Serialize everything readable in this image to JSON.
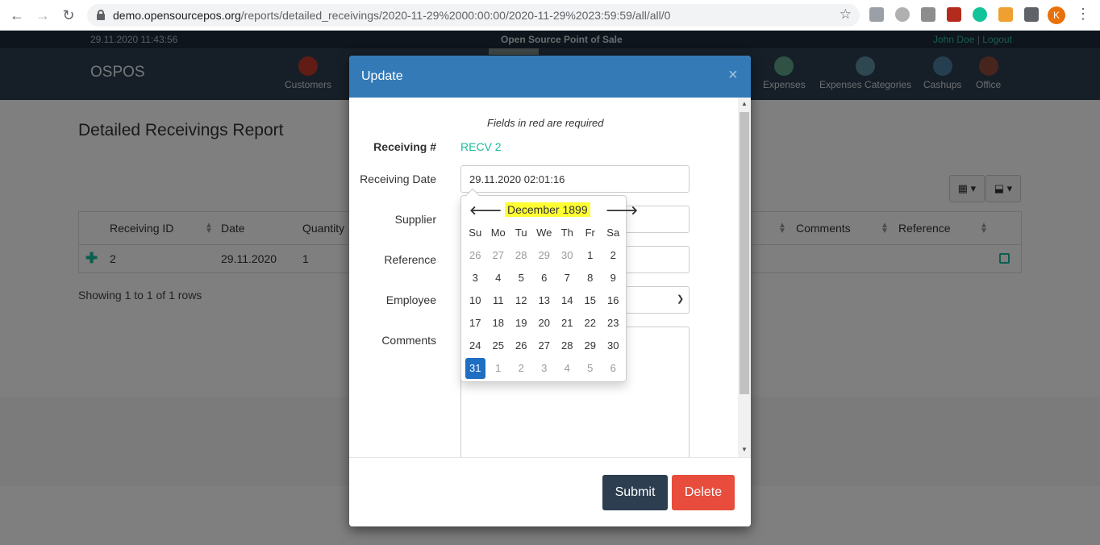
{
  "browser": {
    "url_host": "demo.opensourcepos.org",
    "url_path": "/reports/detailed_receivings/2020-11-29%2000:00:00/2020-11-29%2023:59:59/all/all/0",
    "profile_initial": "K"
  },
  "app": {
    "datetime": "29.11.2020 11:43:56",
    "title": "Open Source Point of Sale",
    "user": "John Doe",
    "separator": "|",
    "logout": "Logout",
    "brand": "OSPOS",
    "nav": [
      {
        "label": "Customers",
        "icon": "customers-icon"
      },
      {
        "label": "Expenses",
        "icon": "expenses-icon"
      },
      {
        "label": "Expenses Categories",
        "icon": "expenses-categories-icon"
      },
      {
        "label": "Cashups",
        "icon": "cashups-icon"
      },
      {
        "label": "Office",
        "icon": "office-icon"
      }
    ]
  },
  "report": {
    "title": "Detailed Receivings Report",
    "columns": [
      "Receiving ID",
      "Date",
      "Quantity",
      "Comments",
      "Reference"
    ],
    "row": {
      "id": "2",
      "date": "29.11.2020",
      "quantity": "1"
    },
    "showing": "Showing 1 to 1 of 1 rows"
  },
  "modal": {
    "title": "Update",
    "close": "×",
    "required_note": "Fields in red are required",
    "labels": {
      "receiving_no": "Receiving #",
      "receiving_date": "Receiving Date",
      "supplier": "Supplier",
      "reference": "Reference",
      "employee": "Employee",
      "comments": "Comments"
    },
    "receiving_no_value": "RECV 2",
    "receiving_date_value": "29.11.2020 02:01:16",
    "submit": "Submit",
    "delete": "Delete"
  },
  "datepicker": {
    "month": "December 1899",
    "prev": "🡐",
    "next": "🡒",
    "dow": [
      "Su",
      "Mo",
      "Tu",
      "We",
      "Th",
      "Fr",
      "Sa"
    ],
    "weeks": [
      [
        {
          "d": "26",
          "o": true
        },
        {
          "d": "27",
          "o": true
        },
        {
          "d": "28",
          "o": true
        },
        {
          "d": "29",
          "o": true
        },
        {
          "d": "30",
          "o": true
        },
        {
          "d": "1"
        },
        {
          "d": "2"
        }
      ],
      [
        {
          "d": "3"
        },
        {
          "d": "4"
        },
        {
          "d": "5"
        },
        {
          "d": "6"
        },
        {
          "d": "7"
        },
        {
          "d": "8"
        },
        {
          "d": "9"
        }
      ],
      [
        {
          "d": "10"
        },
        {
          "d": "11"
        },
        {
          "d": "12"
        },
        {
          "d": "13"
        },
        {
          "d": "14"
        },
        {
          "d": "15"
        },
        {
          "d": "16"
        }
      ],
      [
        {
          "d": "17"
        },
        {
          "d": "18"
        },
        {
          "d": "19"
        },
        {
          "d": "20"
        },
        {
          "d": "21"
        },
        {
          "d": "22"
        },
        {
          "d": "23"
        }
      ],
      [
        {
          "d": "24"
        },
        {
          "d": "25"
        },
        {
          "d": "26"
        },
        {
          "d": "27"
        },
        {
          "d": "28"
        },
        {
          "d": "29"
        },
        {
          "d": "30"
        }
      ],
      [
        {
          "d": "31",
          "a": true
        },
        {
          "d": "1",
          "o": true
        },
        {
          "d": "2",
          "o": true
        },
        {
          "d": "3",
          "o": true
        },
        {
          "d": "4",
          "o": true
        },
        {
          "d": "5",
          "o": true
        },
        {
          "d": "6",
          "o": true
        }
      ]
    ],
    "highlight_color": "#ffff33",
    "active_color": "#1e6ec2"
  }
}
